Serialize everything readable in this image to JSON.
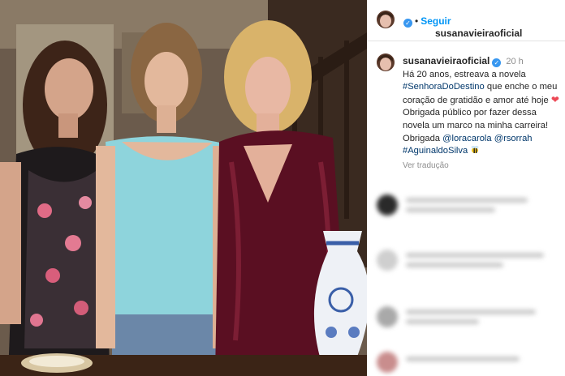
{
  "header": {
    "username": "susanavieiraoficial",
    "verified": true,
    "separator": "•",
    "follow_label": "Seguir"
  },
  "post": {
    "username": "susanavieiraoficial",
    "time": "20 h",
    "caption": {
      "line1": "Há 20 anos, estreava a novela",
      "tag_novela": "#SenhoraDoDestino",
      "line2": " que enche o meu coração de gratidão e amor até hoje",
      "line3": " Obrigada público por fazer dessa novela um marco na minha carreira! Obrigada ",
      "mention1": "@loracarola",
      "mention2": "@rsorrah",
      "tag_author": "#AguinaldoSilva"
    },
    "translate_label": "Ver tradução"
  },
  "icons": {
    "verified": "verified-check-icon",
    "heart": "red-heart-icon",
    "bee": "bee-icon"
  },
  "colors": {
    "link": "#00376b",
    "follow": "#0095f6",
    "verified": "#3897f0",
    "heart": "#ed4956"
  }
}
